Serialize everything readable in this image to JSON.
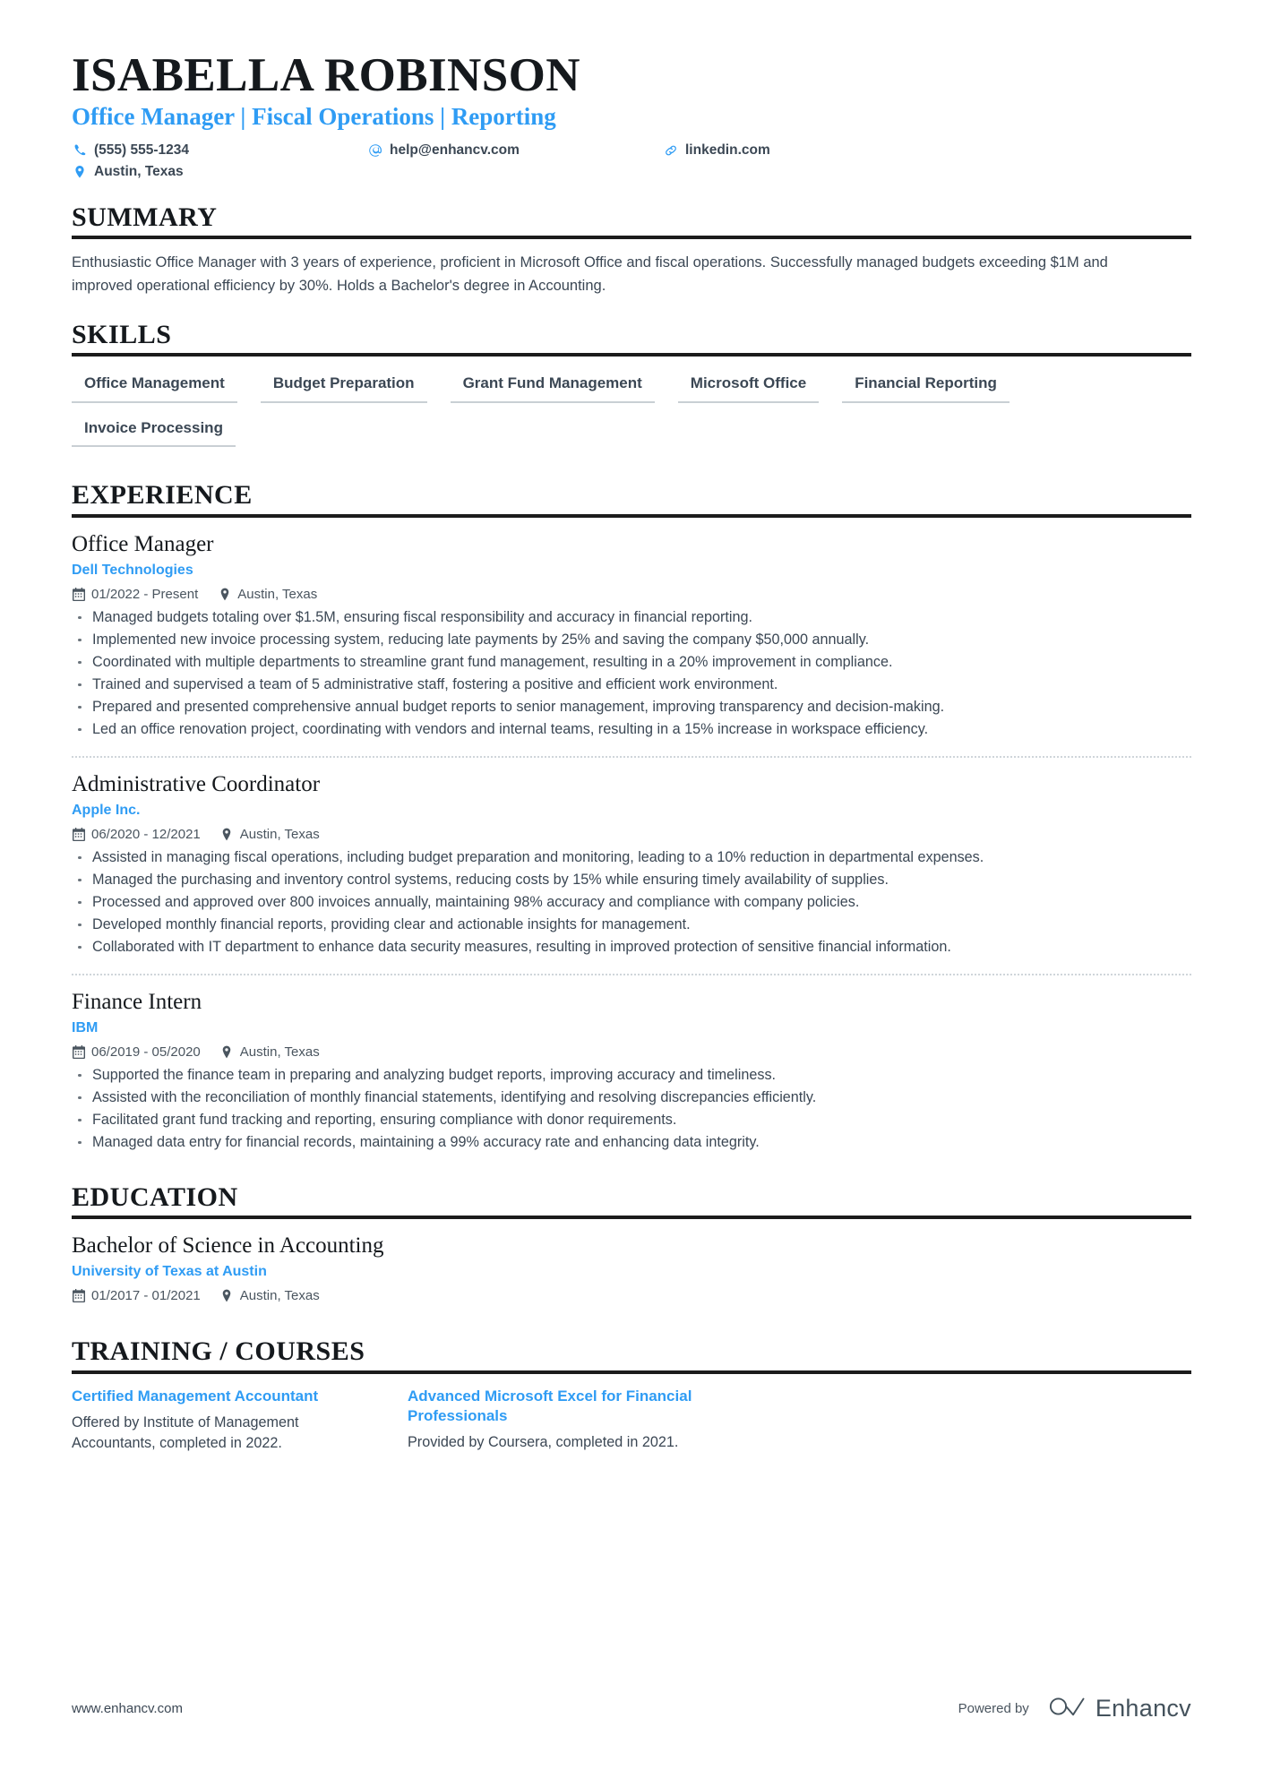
{
  "header": {
    "name": "ISABELLA ROBINSON",
    "headline": "Office Manager | Fiscal Operations | Reporting",
    "contacts": [
      {
        "icon": "phone-icon",
        "text": "(555) 555-1234"
      },
      {
        "icon": "email-icon",
        "text": "help@enhancv.com"
      },
      {
        "icon": "link-icon",
        "text": "linkedin.com"
      },
      {
        "icon": "location-icon",
        "text": "Austin, Texas"
      }
    ]
  },
  "sections": {
    "summary": {
      "title": "SUMMARY",
      "text": "Enthusiastic Office Manager with 3 years of experience, proficient in Microsoft Office and fiscal operations. Successfully managed budgets exceeding $1M and improved operational efficiency by 30%. Holds a Bachelor's degree in Accounting."
    },
    "skills": {
      "title": "SKILLS",
      "items": [
        "Office Management",
        "Budget Preparation",
        "Grant Fund Management",
        "Microsoft Office",
        "Financial Reporting",
        "Invoice Processing"
      ]
    },
    "experience": {
      "title": "EXPERIENCE",
      "entries": [
        {
          "role": "Office Manager",
          "company": "Dell Technologies",
          "dates": "01/2022 - Present",
          "location": "Austin, Texas",
          "bullets": [
            "Managed budgets totaling over $1.5M, ensuring fiscal responsibility and accuracy in financial reporting.",
            "Implemented new invoice processing system, reducing late payments by 25% and saving the company $50,000 annually.",
            "Coordinated with multiple departments to streamline grant fund management, resulting in a 20% improvement in compliance.",
            "Trained and supervised a team of 5 administrative staff, fostering a positive and efficient work environment.",
            "Prepared and presented comprehensive annual budget reports to senior management, improving transparency and decision-making.",
            "Led an office renovation project, coordinating with vendors and internal teams, resulting in a 15% increase in workspace efficiency."
          ]
        },
        {
          "role": "Administrative Coordinator",
          "company": "Apple Inc.",
          "dates": "06/2020 - 12/2021",
          "location": "Austin, Texas",
          "bullets": [
            "Assisted in managing fiscal operations, including budget preparation and monitoring, leading to a 10% reduction in departmental expenses.",
            "Managed the purchasing and inventory control systems, reducing costs by 15% while ensuring timely availability of supplies.",
            "Processed and approved over 800 invoices annually, maintaining 98% accuracy and compliance with company policies.",
            "Developed monthly financial reports, providing clear and actionable insights for management.",
            "Collaborated with IT department to enhance data security measures, resulting in improved protection of sensitive financial information."
          ]
        },
        {
          "role": "Finance Intern",
          "company": "IBM",
          "dates": "06/2019 - 05/2020",
          "location": "Austin, Texas",
          "bullets": [
            "Supported the finance team in preparing and analyzing budget reports, improving accuracy and timeliness.",
            "Assisted with the reconciliation of monthly financial statements, identifying and resolving discrepancies efficiently.",
            "Facilitated grant fund tracking and reporting, ensuring compliance with donor requirements.",
            "Managed data entry for financial records, maintaining a 99% accuracy rate and enhancing data integrity."
          ]
        }
      ]
    },
    "education": {
      "title": "EDUCATION",
      "entries": [
        {
          "degree": "Bachelor of Science in Accounting",
          "school": "University of Texas at Austin",
          "dates": "01/2017 - 01/2021",
          "location": "Austin, Texas"
        }
      ]
    },
    "training": {
      "title": "TRAINING / COURSES",
      "courses": [
        {
          "name": "Certified Management Accountant",
          "description": "Offered by Institute of Management Accountants, completed in 2022."
        },
        {
          "name": "Advanced Microsoft Excel for Financial Professionals",
          "description": "Provided by Coursera, completed in 2021."
        }
      ]
    }
  },
  "footer": {
    "website": "www.enhancv.com",
    "powered_by": "Powered by",
    "brand": "Enhancv"
  },
  "colors": {
    "accent_blue": "#2f9cf4",
    "text_dark": "#3b4754",
    "heading_black": "#15191d",
    "rule_black": "#1c1c1c",
    "chip_border": "#c9cfd4"
  }
}
